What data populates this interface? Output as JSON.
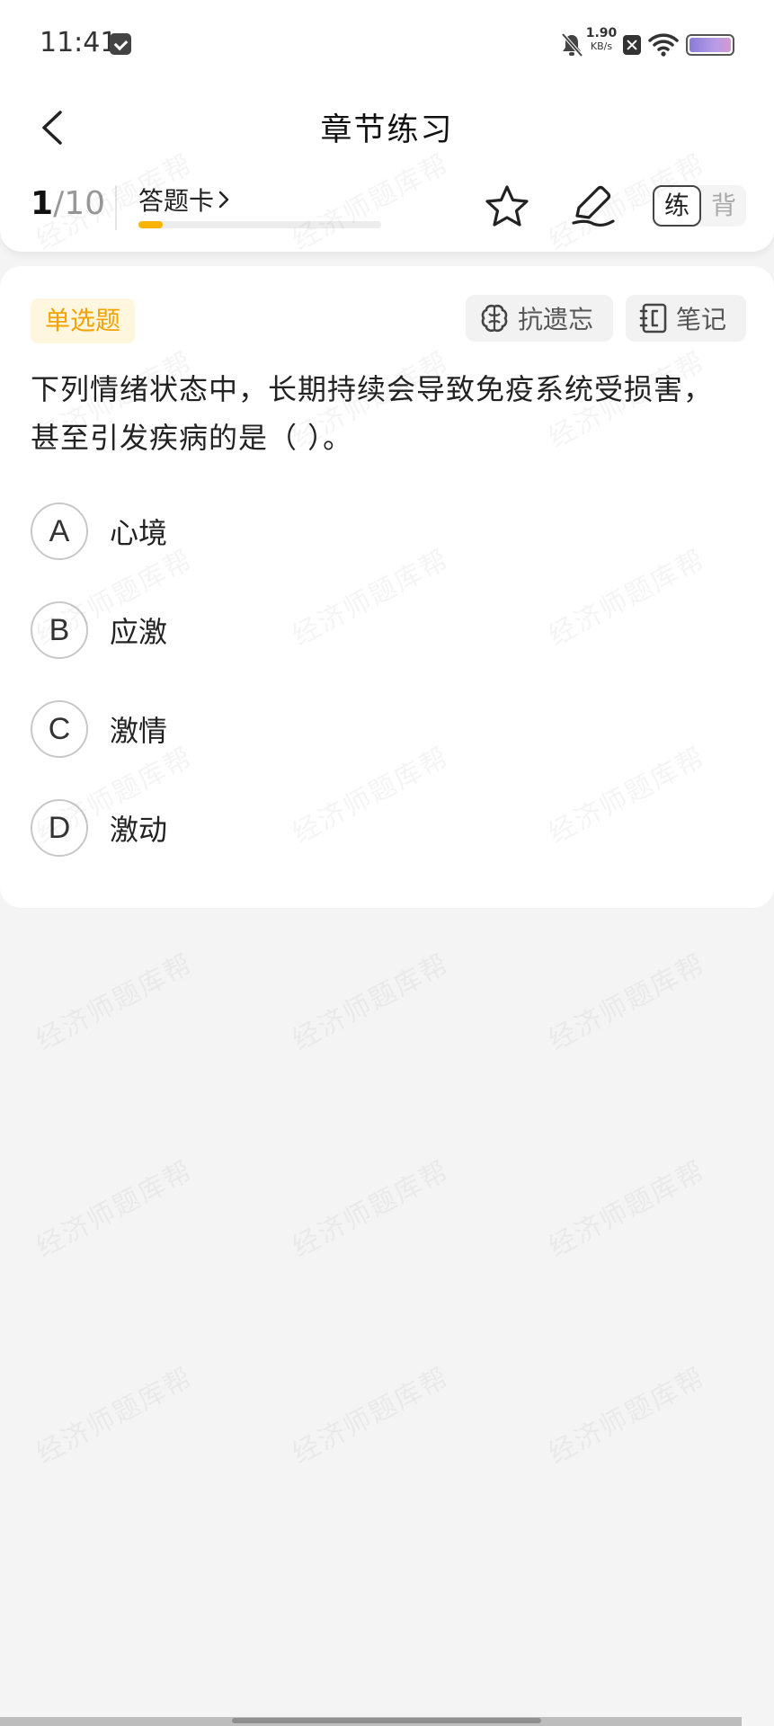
{
  "status_bar": {
    "time": "11:41",
    "net_speed_value": "1.90",
    "net_speed_unit": "KB/s",
    "icons": [
      "message-icon",
      "mute-bell-icon",
      "sim-error-icon",
      "wifi-icon",
      "battery-icon"
    ]
  },
  "header": {
    "title": "章节练习"
  },
  "toolbar": {
    "progress_current": "1",
    "progress_total": "/10",
    "answer_card_label": "答题卡",
    "mode_practice": "练",
    "mode_memorize": "背",
    "progress_fraction": 0.1
  },
  "question": {
    "type_label": "单选题",
    "anti_forget_label": "抗遗忘",
    "notes_label": "笔记",
    "text": "下列情绪状态中，长期持续会导致免疫系统受损害，甚至引发疾病的是（ ）。",
    "options": [
      {
        "letter": "A",
        "text": "心境"
      },
      {
        "letter": "B",
        "text": "应激"
      },
      {
        "letter": "C",
        "text": "激情"
      },
      {
        "letter": "D",
        "text": "激动"
      }
    ]
  },
  "watermark": {
    "text": "经济师题库帮"
  },
  "colors": {
    "accent": "#f8b400",
    "badge_text": "#f4a300",
    "badge_bg": "#fff6e0",
    "background": "#f4f4f4"
  }
}
